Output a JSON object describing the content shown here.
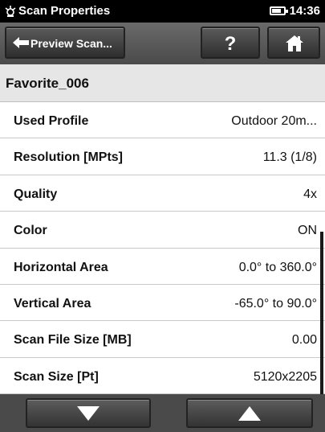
{
  "status_bar": {
    "app_title": "Scan Properties",
    "time": "14:36",
    "icons": [
      "scanner-app-icon",
      "battery-icon"
    ]
  },
  "toolbar": {
    "back_label": "Preview Scan...",
    "help_label": "?",
    "icons": [
      "left-arrow-icon",
      "home-icon"
    ]
  },
  "favorite": {
    "name": "Favorite_006"
  },
  "properties": [
    {
      "label": "Used Profile",
      "value": "Outdoor 20m..."
    },
    {
      "label": "Resolution [MPts]",
      "value": "11.3 (1/8)"
    },
    {
      "label": "Quality",
      "value": "4x"
    },
    {
      "label": "Color",
      "value": "ON"
    },
    {
      "label": "Horizontal Area",
      "value": "0.0° to 360.0°"
    },
    {
      "label": "Vertical Area",
      "value": "-65.0° to 90.0°"
    },
    {
      "label": "Scan File Size [MB]",
      "value": "0.00"
    },
    {
      "label": "Scan Size [Pt]",
      "value": "5120x2205"
    }
  ],
  "bottom_nav": {
    "icons": [
      "chevron-down-icon",
      "chevron-up-icon"
    ]
  }
}
